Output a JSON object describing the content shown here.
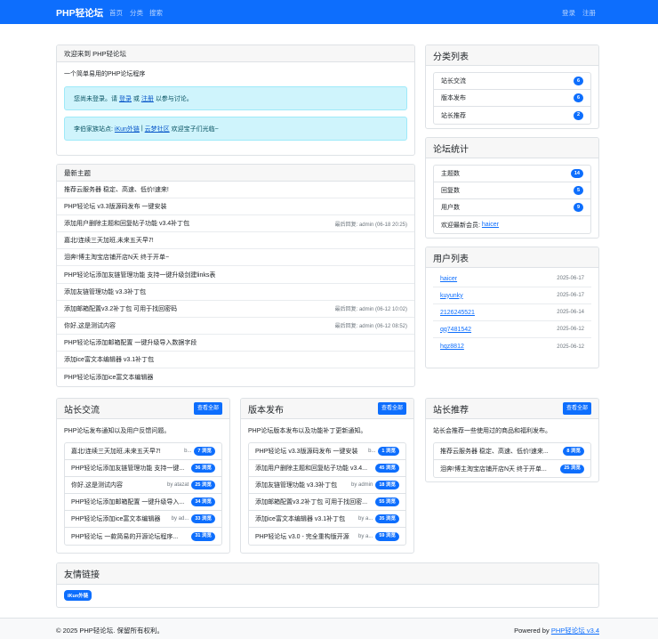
{
  "nav": {
    "brand": "PHP轻论坛",
    "home": "首页",
    "category": "分类",
    "search": "搜索",
    "login": "登录",
    "register": "注册"
  },
  "welcome": {
    "title": "欢迎来到 PHP轻论坛",
    "tagline": "一个简单易用的PHP论坛程序",
    "login_prefix": "您尚未登录。请",
    "login_link": "登录",
    "or": "或",
    "register_link": "注册",
    "login_suffix": "以参与讨论。",
    "sister_prefix": "李伯家族站点:",
    "sister_link1": "iKun外链",
    "sister_sep": "|",
    "sister_link2": "云梦社区",
    "sister_suffix": "欢迎宝子们光临~"
  },
  "latest": {
    "title": "最新主题",
    "items": [
      {
        "title": "推荐云服务器 稳定、高速、低价!速来!",
        "meta": ""
      },
      {
        "title": "PHP轻论坛 v3.3版源码发布 一键安装",
        "meta": ""
      },
      {
        "title": "添加用户删除主题和回复帖子功能 v3.4补丁包",
        "meta": "最后回复: admin (06-18 20:25)"
      },
      {
        "title": "嘉北!连续三天加班,未来五天早7!",
        "meta": ""
      },
      {
        "title": "泪奔!博主淘宝店铺开店N天 终于开单~",
        "meta": ""
      },
      {
        "title": "PHP轻论坛添加友链管理功能 支持一键升级剑建links表",
        "meta": ""
      },
      {
        "title": "添加友链管理功能 v3.3补丁包",
        "meta": ""
      },
      {
        "title": "添加邮箱配置v3.2补丁包 可用于找回密码",
        "meta": "最后回复: admin (06-12 10:02)"
      },
      {
        "title": "你好,这是测试内容",
        "meta": "最后回复: admin (06-12 08:52)"
      },
      {
        "title": "PHP轻论坛添加邮箱配置 一键升级导入数据字段",
        "meta": ""
      },
      {
        "title": "添加ice富文本编辑器 v3.1补丁包",
        "meta": ""
      },
      {
        "title": "PHP轻论坛添加ice富文本编辑器",
        "meta": ""
      }
    ]
  },
  "categories": {
    "title": "分类列表",
    "items": [
      {
        "name": "站长交流",
        "count": "6"
      },
      {
        "name": "版本发布",
        "count": "6"
      },
      {
        "name": "站长推荐",
        "count": "2"
      }
    ]
  },
  "stats": {
    "title": "论坛统计",
    "items": [
      {
        "name": "主题数",
        "count": "14"
      },
      {
        "name": "回复数",
        "count": "5"
      },
      {
        "name": "用户数",
        "count": "9"
      }
    ],
    "newest_label": "欢迎最新会员:",
    "newest_user": "haicer"
  },
  "users": {
    "title": "用户列表",
    "items": [
      {
        "name": "haicer",
        "date": "2025-06-17"
      },
      {
        "name": "kuyunky",
        "date": "2025-06-17"
      },
      {
        "name": "2126245521",
        "date": "2025-06-14"
      },
      {
        "name": "qq7481542",
        "date": "2025-06-12"
      },
      {
        "name": "hqz8812",
        "date": "2025-06-12"
      }
    ]
  },
  "sections": [
    {
      "title": "站长交流",
      "button": "查看全部",
      "desc": "PHP论坛发布通知以及用户反馈问题。",
      "items": [
        {
          "title": "嘉北!连续三天加班,未来五天早7!",
          "by": "b...",
          "badge": "7 浏览"
        },
        {
          "title": "PHP轻论坛添加友链管理功能 支持一键...",
          "by": "",
          "badge": "36 浏览"
        },
        {
          "title": "你好,这是测试内容",
          "by": "by atazat",
          "badge": "25 浏览"
        },
        {
          "title": "PHP轻论坛添加邮箱配置 一键升级导入...",
          "by": "",
          "badge": "34 浏览"
        },
        {
          "title": "PHP轻论坛添加ice富文本编辑器",
          "by": "by ad...",
          "badge": "33 浏览"
        },
        {
          "title": "PHP轻论坛 一款简易的开源论坛程序...",
          "by": "",
          "badge": "31 浏览"
        }
      ]
    },
    {
      "title": "版本发布",
      "button": "查看全部",
      "desc": "PHP论坛版本发布以及功能补丁更新通知。",
      "items": [
        {
          "title": "PHP轻论坛 v3.3版源码发布 一键安装",
          "by": "b...",
          "badge": "1 浏览"
        },
        {
          "title": "添加用户删除主题和回复帖子功能 v3.4...",
          "by": "",
          "badge": "45 浏览"
        },
        {
          "title": "添加友链管理功能 v3.3补丁包",
          "by": "by admin",
          "badge": "18 浏览"
        },
        {
          "title": "添加邮箱配置v3.2补丁包 可用于找回密...",
          "by": "",
          "badge": "55 浏览"
        },
        {
          "title": "添加ice富文本编辑器 v3.1补丁包",
          "by": "by a...",
          "badge": "35 浏览"
        },
        {
          "title": "PHP轻论坛 v3.0 - 完全重构版开源",
          "by": "by a...",
          "badge": "59 浏览"
        }
      ]
    },
    {
      "title": "站长推荐",
      "button": "查看全部",
      "desc": "站长会推荐一些使用过的商品和福利发布。",
      "items": [
        {
          "title": "推荐云服务器 稳定、高速、低价!速来...",
          "by": "",
          "badge": "8 浏览"
        },
        {
          "title": "泪奔!博主淘宝店铺开店N天 终于开单...",
          "by": "",
          "badge": "25 浏览"
        }
      ]
    }
  ],
  "friends": {
    "title": "友情链接",
    "links": [
      "iKun外链"
    ]
  },
  "footer": {
    "copyright": "© 2025 PHP轻论坛. 保留所有权利。",
    "powered_prefix": "Powered by",
    "powered_link": "PHP轻论坛 v3.4"
  },
  "colors": {
    "primary": "#0d6efd",
    "info_bg": "#cff4fc",
    "header_bg": "#f7f7f7"
  }
}
